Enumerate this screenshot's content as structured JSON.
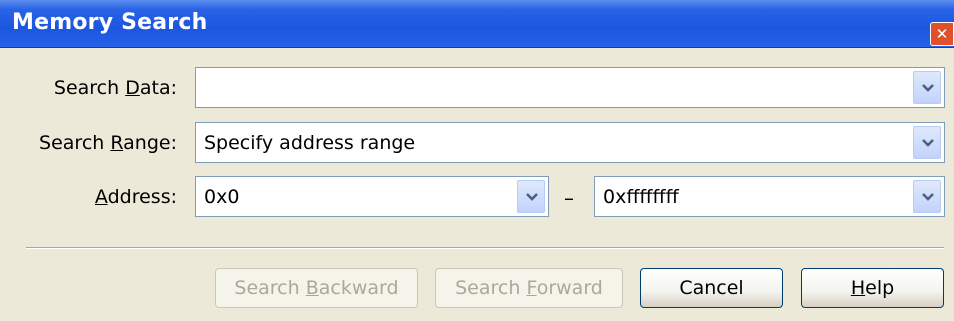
{
  "window": {
    "title": "Memory Search",
    "close_glyph": "✕"
  },
  "fields": {
    "search_data": {
      "label_pre": "Search ",
      "label_u": "D",
      "label_post": "ata:",
      "value": ""
    },
    "search_range": {
      "label_pre": "Search ",
      "label_u": "R",
      "label_post": "ange:",
      "value": "Specify address range"
    },
    "address": {
      "label_pre": "",
      "label_u": "A",
      "label_post": "ddress:",
      "from": "0x0",
      "separator": "–",
      "to": "0xffffffff"
    }
  },
  "buttons": {
    "search_backward": {
      "pre": "Search ",
      "u": "B",
      "post": "ackward",
      "enabled": false
    },
    "search_forward": {
      "pre": "Search ",
      "u": "F",
      "post": "orward",
      "enabled": false
    },
    "cancel": {
      "pre": "Cancel",
      "u": "",
      "post": ""
    },
    "help": {
      "pre": "",
      "u": "H",
      "post": "elp"
    }
  },
  "icons": {
    "dropdown": "chevron-down-icon",
    "close": "close-icon"
  },
  "colors": {
    "titlebar": "#2563e8",
    "close": "#e0502a",
    "dialog_bg": "#ece9d8",
    "field_border": "#7f9db9"
  }
}
